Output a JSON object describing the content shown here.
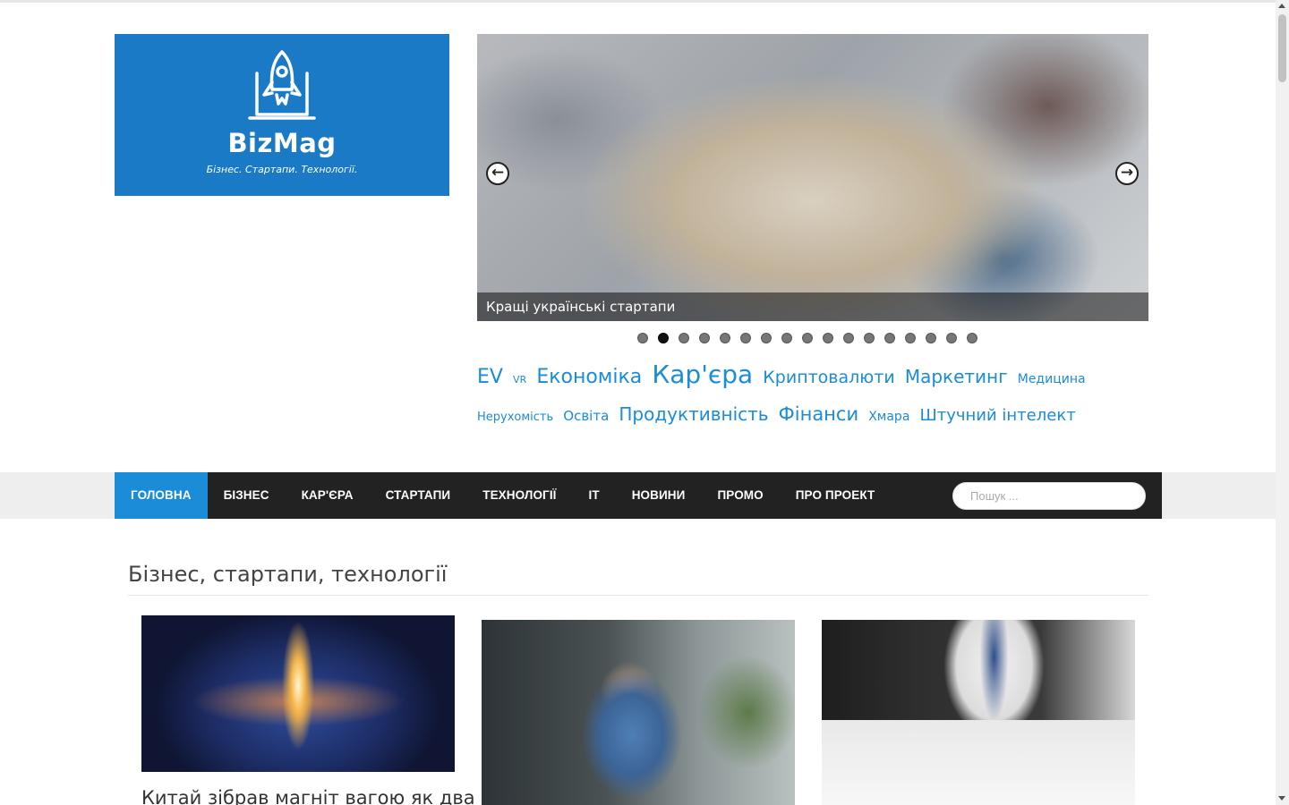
{
  "site": {
    "logo_name": "BizMag",
    "logo_tagline": "Бізнес. Стартапи. Технології.",
    "brand_color": "#1a7ac6",
    "accent_color": "#1a8cd8"
  },
  "slider": {
    "caption": "Кращі українські стартапи",
    "prev_icon": "arrow-left-icon",
    "next_icon": "arrow-right-icon",
    "prev_glyph": "←",
    "next_glyph": "→",
    "dot_count": 17,
    "active_dot_index": 1
  },
  "tags": [
    {
      "label": "EV",
      "size": 22
    },
    {
      "label": "VR",
      "size": 11
    },
    {
      "label": "Економіка",
      "size": 22
    },
    {
      "label": "Кар'єра",
      "size": 28
    },
    {
      "label": "Криптовалюти",
      "size": 19
    },
    {
      "label": "Маркетинг",
      "size": 20
    },
    {
      "label": "Медицина",
      "size": 14
    },
    {
      "label": "Нерухомість",
      "size": 13
    },
    {
      "label": "Освіта",
      "size": 15
    },
    {
      "label": "Продуктивність",
      "size": 20
    },
    {
      "label": "Фінанси",
      "size": 21
    },
    {
      "label": "Хмара",
      "size": 14
    },
    {
      "label": "Штучний інтелект",
      "size": 18
    }
  ],
  "nav": {
    "items": [
      "Головна",
      "Бізнес",
      "Кар'єра",
      "Стартапи",
      "Технології",
      "IT",
      "Новини",
      "Промо",
      "Про проект"
    ],
    "active_index": 0,
    "search_placeholder": "Пошук ..."
  },
  "section": {
    "title": "Бізнес, стартапи, технології",
    "first_card_title": "Китай зібрав магніт вагою як два"
  }
}
